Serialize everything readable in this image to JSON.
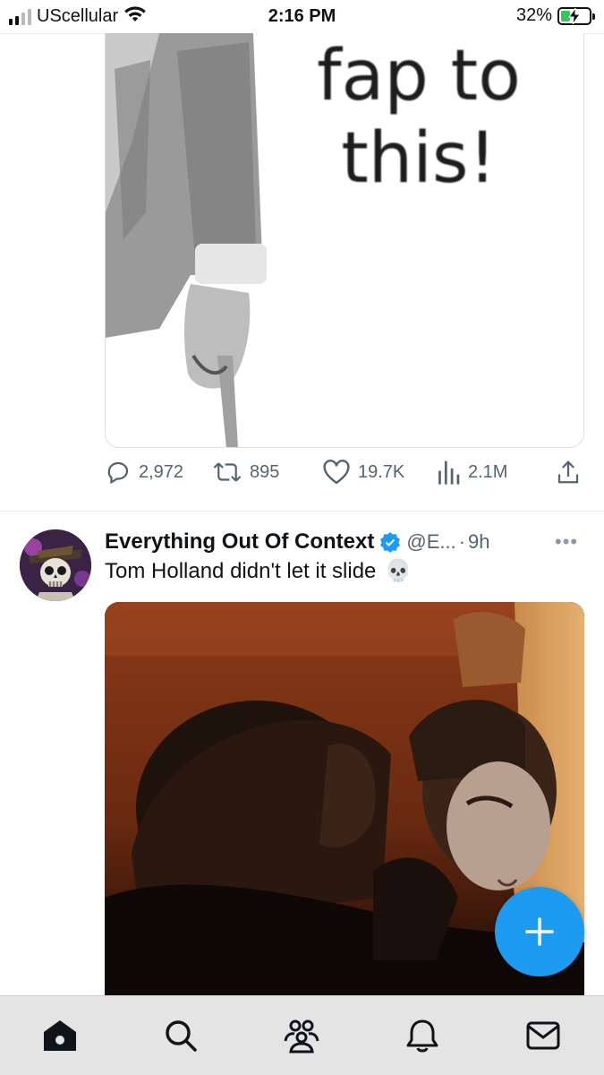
{
  "status_bar": {
    "carrier": "UScellular",
    "time": "2:16 PM",
    "battery_percent": "32%",
    "battery_level": 0.32
  },
  "post_1": {
    "meme_text_line1": "fap to",
    "meme_text_line2": "this!",
    "actions": {
      "replies": "2,972",
      "reposts": "895",
      "likes": "19.7K",
      "views": "2.1M"
    }
  },
  "post_2": {
    "author_name": "Everything Out Of Context",
    "handle": "@E...",
    "separator": "·",
    "time": "9h",
    "text": "Tom Holland didn't let it slide",
    "emoji": "💀",
    "more_label": "•••"
  },
  "tabs": [
    "home-icon",
    "search-icon",
    "communities-icon",
    "notifications-icon",
    "messages-icon"
  ],
  "colors": {
    "accent": "#1d9bf0",
    "muted_text": "#536471",
    "battery_green": "#34c759"
  }
}
